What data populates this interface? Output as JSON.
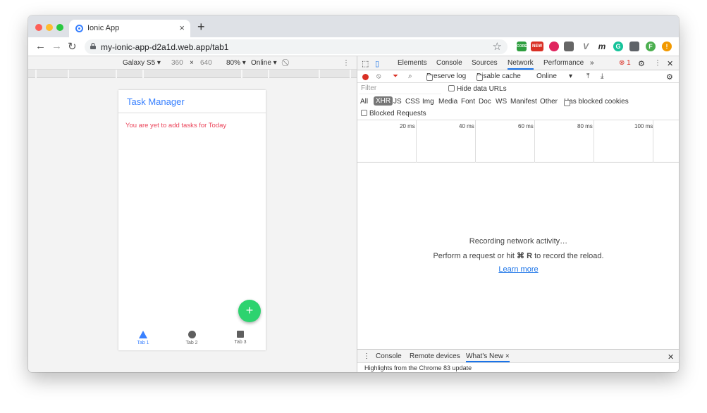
{
  "browser": {
    "tab_title": "Ionic App",
    "url": "my-ionic-app-d2a1d.web.app/tab1",
    "new_tab_label": "+",
    "extensions": [
      {
        "name": "green-extension-icon",
        "color": "#2e9e3f",
        "text": "CORE"
      },
      {
        "name": "new-badge-extension-icon",
        "color": "#d93025",
        "text": "NEW"
      },
      {
        "name": "target-extension-icon",
        "color": "#e0245e",
        "text": ""
      },
      {
        "name": "bug-extension-icon",
        "color": "#666666",
        "text": ""
      },
      {
        "name": "vue-extension-icon",
        "color": "#888888",
        "text": "V"
      },
      {
        "name": "m-extension-icon",
        "color": "#333333",
        "text": "m"
      },
      {
        "name": "grammarly-extension-icon",
        "color": "#15c39a",
        "text": "G"
      },
      {
        "name": "puzzle-extension-icon",
        "color": "#5f6368",
        "text": ""
      },
      {
        "name": "profile-avatar",
        "color": "#4caf50",
        "text": "F"
      },
      {
        "name": "update-alert-icon",
        "color": "#f29900",
        "text": "!"
      }
    ]
  },
  "device_toolbar": {
    "device": "Galaxy S5",
    "width": "360",
    "times": "×",
    "height": "640",
    "zoom": "80%",
    "network": "Online"
  },
  "app": {
    "title": "Task Manager",
    "empty_message": "You are yet to add tasks for Today",
    "fab_label": "+",
    "tabs": [
      {
        "label": "Tab 1",
        "active": true,
        "color": "#3880ff"
      },
      {
        "label": "Tab 2",
        "active": false,
        "color": "#666666"
      },
      {
        "label": "Tab 3",
        "active": false,
        "color": "#666666"
      }
    ]
  },
  "devtools": {
    "tabs": [
      "Elements",
      "Console",
      "Sources",
      "Network",
      "Performance",
      "»"
    ],
    "active_tab": "Network",
    "error_count": "1",
    "preserve_log": "Preserve log",
    "disable_cache": "Disable cache",
    "throttle": "Online",
    "filter_placeholder": "Filter",
    "hide_data_urls": "Hide data URLs",
    "types": [
      "All",
      "XHR",
      "JS",
      "CSS",
      "Img",
      "Media",
      "Font",
      "Doc",
      "WS",
      "Manifest",
      "Other"
    ],
    "selected_type": "XHR",
    "has_blocked_cookies": "Has blocked cookies",
    "blocked_requests": "Blocked Requests",
    "timeline_ticks": [
      "20 ms",
      "40 ms",
      "60 ms",
      "80 ms",
      "100 ms"
    ],
    "recording": "Recording network activity…",
    "hint_prefix": "Perform a request or hit ",
    "hint_key": "⌘ R",
    "hint_suffix": " to record the reload.",
    "learn_more": "Learn more",
    "drawer_tabs": [
      "Console",
      "Remote devices",
      "What's New"
    ],
    "drawer_active": "What's New",
    "drawer_text": "Highlights from the Chrome 83 update"
  }
}
